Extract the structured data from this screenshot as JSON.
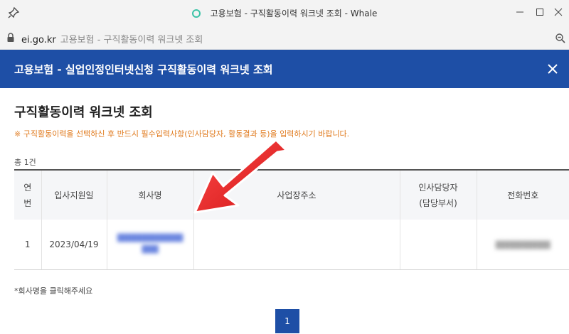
{
  "window": {
    "title": "고용보험 - 구직활동이력 워크넷 조회 - Whale"
  },
  "address": {
    "host": "ei.go.kr",
    "path": "고용보험 - 구직활동이력 워크넷 조회"
  },
  "header": {
    "title": "고용보험 - 실업인정인터넷신청 구직활동이력 워크넷 조회"
  },
  "main": {
    "title": "구직활동이력 워크넷 조회",
    "notice": "※ 구직활동이력을 선택하신 후 반드시 필수입력사항(인사담당자, 활동결과 등)을 입력하시기 바랍니다.",
    "total": "총 1건",
    "footnote": "*회사명을 클릭해주세요"
  },
  "table": {
    "headers": {
      "no_line1": "연",
      "no_line2": "번",
      "date": "입사지원일",
      "company": "회사명",
      "address": "사업장주소",
      "hr_line1": "인사담당자",
      "hr_line2": "(담당부서)",
      "phone": "전화번호"
    },
    "rows": [
      {
        "no": "1",
        "date": "2023/04/19",
        "company_line1": "████████████",
        "company_line2": "███",
        "address": "",
        "hr": "",
        "phone": "██████████"
      }
    ]
  },
  "pagination": {
    "current": "1"
  },
  "colors": {
    "header_blue": "#1e4fa6",
    "notice_orange": "#e07b1f",
    "arrow_red": "#e8201f"
  }
}
